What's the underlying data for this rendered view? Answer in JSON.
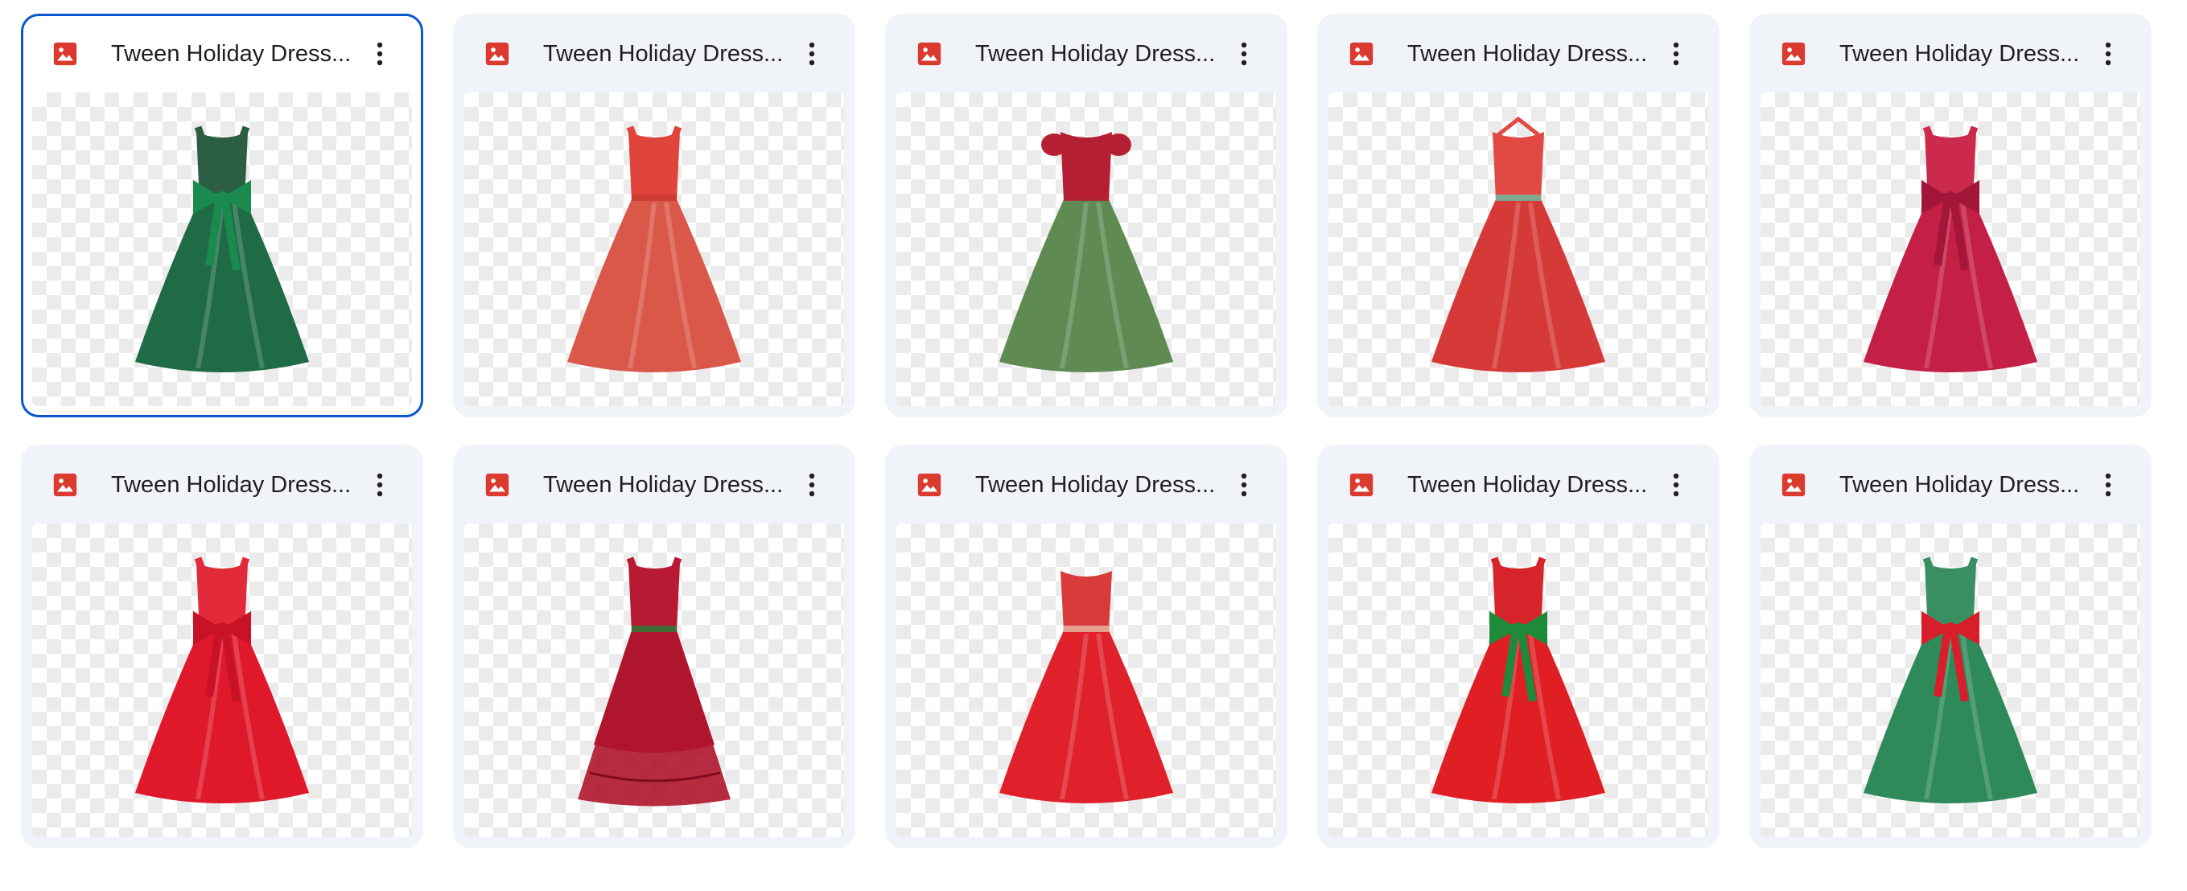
{
  "files": [
    {
      "title": "Tween Holiday Dress...",
      "selected": true,
      "icon": "image-file-icon",
      "dress": {
        "skirt": "#1f6b45",
        "bodice": "#2c5e44",
        "accent": "#1a8a4e",
        "style": "bow"
      }
    },
    {
      "title": "Tween Holiday Dress...",
      "selected": false,
      "icon": "image-file-icon",
      "dress": {
        "skirt": "#d9584a",
        "bodice": "#e0453b",
        "accent": "#c93a30",
        "style": "plain"
      }
    },
    {
      "title": "Tween Holiday Dress...",
      "selected": false,
      "icon": "image-file-icon",
      "dress": {
        "skirt": "#5f8a52",
        "bodice": "#b51f34",
        "accent": "#b51f34",
        "style": "puff"
      }
    },
    {
      "title": "Tween Holiday Dress...",
      "selected": false,
      "icon": "image-file-icon",
      "dress": {
        "skirt": "#d63a38",
        "bodice": "#e04a42",
        "accent": "#6fb8a0",
        "style": "halter"
      }
    },
    {
      "title": "Tween Holiday Dress...",
      "selected": false,
      "icon": "image-file-icon",
      "dress": {
        "skirt": "#c41f45",
        "bodice": "#cc2a4c",
        "accent": "#a3163a",
        "style": "bow"
      }
    },
    {
      "title": "Tween Holiday Dress...",
      "selected": false,
      "icon": "image-file-icon",
      "dress": {
        "skirt": "#e0182b",
        "bodice": "#e32a3a",
        "accent": "#c81226",
        "style": "bow"
      }
    },
    {
      "title": "Tween Holiday Dress...",
      "selected": false,
      "icon": "image-file-icon",
      "dress": {
        "skirt": "#b0152e",
        "bodice": "#b81a34",
        "accent": "#2f7a3a",
        "style": "ruffle"
      }
    },
    {
      "title": "Tween Holiday Dress...",
      "selected": false,
      "icon": "image-file-icon",
      "dress": {
        "skirt": "#e0202a",
        "bodice": "#d93b3b",
        "accent": "#e8b4a0",
        "style": "strapless"
      }
    },
    {
      "title": "Tween Holiday Dress...",
      "selected": false,
      "icon": "image-file-icon",
      "dress": {
        "skirt": "#df1f24",
        "bodice": "#d6252a",
        "accent": "#1f8a3c",
        "style": "bow"
      }
    },
    {
      "title": "Tween Holiday Dress...",
      "selected": false,
      "icon": "image-file-icon",
      "dress": {
        "skirt": "#2f8a5a",
        "bodice": "#3a8f62",
        "accent": "#d81e2a",
        "style": "bow"
      }
    }
  ],
  "colors": {
    "selected_border": "#0b57d0",
    "card_bg": "#f0f4f9",
    "image_icon": "#db3a2f",
    "title_text": "#1f1f1f"
  }
}
